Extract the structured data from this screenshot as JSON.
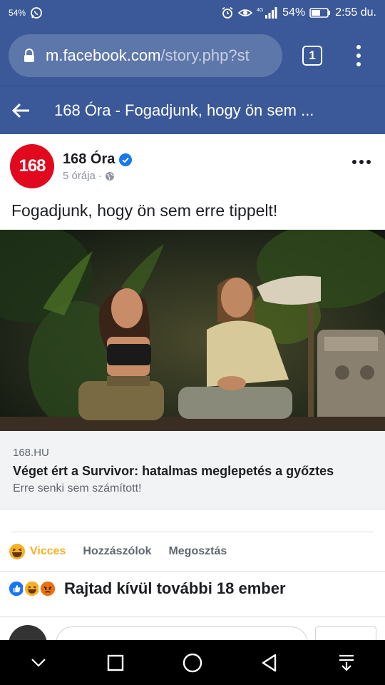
{
  "status_bar": {
    "left_text": "54%",
    "network": "4G",
    "battery": "54%",
    "time": "2:55 du."
  },
  "browser": {
    "url_host": "m.facebook.com",
    "url_path": "/story.php?st",
    "tab_count": "1"
  },
  "fb_header": {
    "title": "168 Óra - Fogadjunk, hogy ön sem ..."
  },
  "post": {
    "avatar_text": "168",
    "page_name": "168 Óra",
    "time": "5 órája ·",
    "text": "Fogadjunk, hogy ön sem erre tippelt!"
  },
  "link": {
    "domain": "168.HU",
    "title": "Véget ért a Survivor: hatalmas meglepetés a győztes",
    "subtitle": "Erre senki sem számított!"
  },
  "actions": {
    "react_label": "Vicces",
    "comment_label": "Hozzászólok",
    "share_label": "Megosztás"
  },
  "reactions": {
    "summary": "Rajtad kívül további 18 ember"
  },
  "colors": {
    "facebook_blue": "#3b5998",
    "haha_yellow": "#f7b125",
    "brand_red": "#e2081e"
  }
}
